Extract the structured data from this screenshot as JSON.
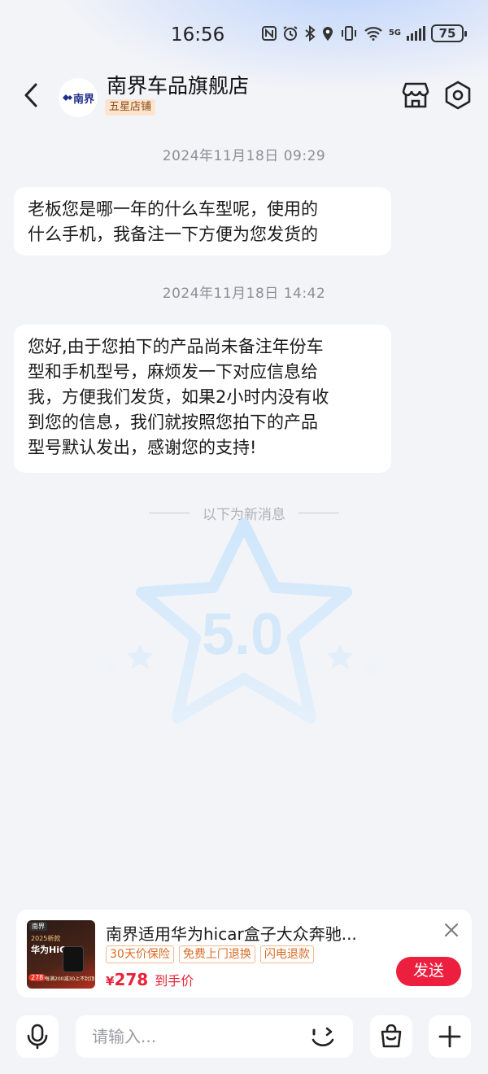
{
  "status_bar": {
    "time": "16:56",
    "network": "5G",
    "battery": "75"
  },
  "header": {
    "shop_name": "南界车品旗舰店",
    "badge": "五星店铺",
    "logo_text": "南界"
  },
  "messages": [
    {
      "timestamp": "2024年11月18日  09:29",
      "lines": [
        "老板您是哪一年的什么车型呢，使用的",
        "什么手机，我备注一下方便为您发货的"
      ]
    },
    {
      "timestamp": "2024年11月18日  14:42",
      "lines": [
        "您好,由于您拍下的产品尚未备注年份车",
        "型和手机型号，麻烦发一下对应信息给",
        "我，方便我们发货，如果2小时内没有收",
        "到您的信息，我们就按照您拍下的产品",
        "型号默认发出，感谢您的支持!"
      ]
    }
  ],
  "divider_text": "以下为新消息",
  "watermark": {
    "score": "5.0"
  },
  "product": {
    "title": "南界适用华为hicar盒子大众奔驰...",
    "tags": [
      "30天价保险",
      "免费上门退换",
      "闪电退款"
    ],
    "currency": "¥",
    "price": "278",
    "price_label": "到手价",
    "send_label": "发送",
    "thumb": {
      "brand": "南界",
      "new_label": "2025新款",
      "title": "华为HiCar",
      "price": "278",
      "note": "每满200减30上不封顶"
    }
  },
  "input": {
    "placeholder": "请输入..."
  },
  "colors": {
    "accent": "#ec1f3e",
    "badge_bg": "#fde4cf",
    "tag": "#d96a24"
  }
}
